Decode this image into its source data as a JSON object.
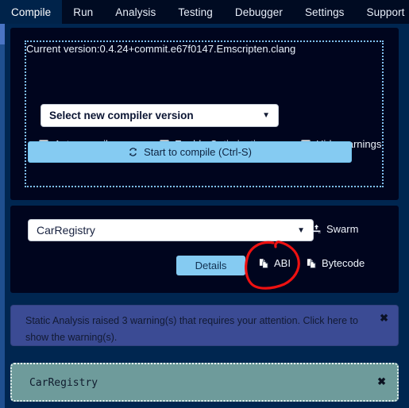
{
  "window": {
    "title": "Compile"
  },
  "tabs": [
    {
      "label": "Compile",
      "active": true,
      "name": "tab-compile"
    },
    {
      "label": "Run",
      "active": false,
      "name": "tab-run"
    },
    {
      "label": "Analysis",
      "active": false,
      "name": "tab-analysis"
    },
    {
      "label": "Testing",
      "active": false,
      "name": "tab-testing"
    },
    {
      "label": "Debugger",
      "active": false,
      "name": "tab-debugger"
    },
    {
      "label": "Settings",
      "active": false,
      "name": "tab-settings"
    },
    {
      "label": "Support",
      "active": false,
      "name": "tab-support"
    }
  ],
  "compiler": {
    "current_version_text": "Current version:0.4.24+commit.e67f0147.Emscripten.clang",
    "version_select": {
      "selected": "Select new compiler version",
      "caret": "▼"
    },
    "checkboxes": [
      {
        "label": "Auto compile",
        "checked": true
      },
      {
        "label": "Enable Optimization",
        "checked": false
      },
      {
        "label": "Hide warnings",
        "checked": false
      }
    ],
    "compile_button": {
      "label": "Start to compile (Ctrl-S)",
      "icon": "refresh-icon"
    }
  },
  "contract": {
    "select": {
      "selected": "CarRegistry",
      "caret": "▼"
    },
    "swarm": {
      "label": "Swarm",
      "icon": "upload-icon"
    },
    "actions": {
      "details_label": "Details",
      "abi_label": "ABI",
      "bytecode_label": "Bytecode",
      "copy_icon": "copy-file-icon"
    }
  },
  "alert": {
    "message": "Static Analysis raised 3 warning(s) that requires your attention. Click here to show the warning(s).",
    "close_label": "✖"
  },
  "contract_box": {
    "name": "CarRegistry",
    "close_label": "✖"
  },
  "annotation": {
    "shape": "hand-drawn-red-circle",
    "target": "ABI",
    "color": "#ee1111"
  },
  "colors": {
    "app_bg": "#002650",
    "panel_bg": "#00051e",
    "tabbar_bg": "#000b22",
    "tab_active_bg": "#00234a",
    "accent_button": "#85cbf2",
    "dotted_border": "#7fbff0",
    "alert_bg": "#3b4b94",
    "contract_box_bg": "#6e9b9b",
    "annotation_red": "#ee1111"
  }
}
